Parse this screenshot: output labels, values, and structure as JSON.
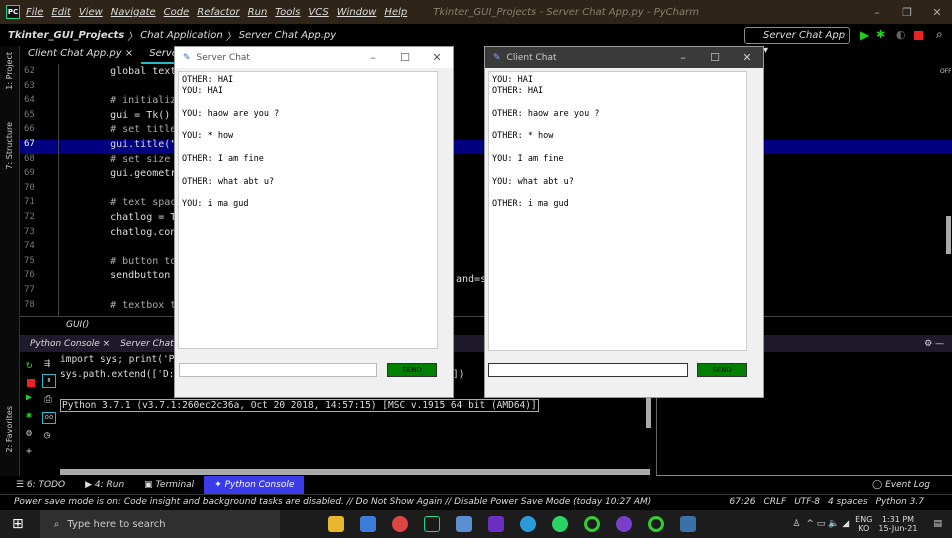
{
  "ide": {
    "menu": [
      "File",
      "Edit",
      "View",
      "Navigate",
      "Code",
      "Refactor",
      "Run",
      "Tools",
      "VCS",
      "Window",
      "Help"
    ],
    "window_title": "Tkinter_GUI_Projects - Server Chat App.py - PyCharm",
    "breadcrumb": [
      "Tkinter_GUI_Projects",
      "Chat Application",
      "Server Chat App.py"
    ],
    "run_config": "Server Chat App",
    "tabs": [
      "Client Chat App.py",
      "Server Chat App.py"
    ],
    "side_tools": [
      "1: Project",
      "7: Structure",
      "2: Favorites"
    ],
    "lines": [
      {
        "n": "62",
        "code": "    global textbox"
      },
      {
        "n": "63",
        "code": ""
      },
      {
        "n": "64",
        "code": "    # initialize tki"
      },
      {
        "n": "65",
        "code": "    gui = Tk()"
      },
      {
        "n": "66",
        "code": "    # set title for"
      },
      {
        "n": "67",
        "code": "    gui.title(\"Serve"
      },
      {
        "n": "68",
        "code": "    # set size for t"
      },
      {
        "n": "69",
        "code": "    gui.geometry(\"40"
      },
      {
        "n": "70",
        "code": ""
      },
      {
        "n": "71",
        "code": "    # text space to"
      },
      {
        "n": "72",
        "code": "    chatlog = Text(g"
      },
      {
        "n": "73",
        "code": "    chatlog.config(s"
      },
      {
        "n": "74",
        "code": ""
      },
      {
        "n": "75",
        "code": "    # button to send"
      },
      {
        "n": "76",
        "code": "    sendbutton = But"
      },
      {
        "n": "77",
        "code": ""
      },
      {
        "n": "78",
        "code": "    # textbox to typ"
      }
    ],
    "code_tail": "and=s",
    "power_off": "OFF",
    "func_crumb": "GUI()",
    "console_tabs": [
      "Python Console",
      "Server Chat"
    ],
    "console_lines": [
      "import sys; print('P",
      "sys.path.extend(['D:"
    ],
    "console_tail": "])",
    "python_banner": "Python 3.7.1 (v3.7.1:260ec2c36a, Oct 20 2018, 14:57:15) [MSC v.1915 64 bit (AMD64)]",
    "bottom_tabs": [
      "6: TODO",
      "4: Run",
      "Terminal",
      "Python Console"
    ],
    "event_log": "Event Log",
    "status_msg": "Power save mode is on: Code insight and background tasks are disabled. // Do Not Show Again // Disable Power Save Mode (today 10:27 AM)",
    "status_right": [
      "67:26",
      "CRLF",
      "UTF-8",
      "4 spaces",
      "Python 3.7"
    ]
  },
  "server": {
    "title": "Server Chat",
    "log": "OTHER: HAI\nYOU: HAI\n\nYOU: haow are you ?\n\nYOU: * how\n\nOTHER: I am fine\n\nOTHER: what abt u?\n\nYOU: i ma gud",
    "entry": "",
    "send": "SEND"
  },
  "client": {
    "title": "Client Chat",
    "log": "YOU: HAI\nOTHER: HAI\n\nOTHER: haow are you ?\n\nOTHER: * how\n\nYOU: I am fine\n\nYOU: what abt u?\n\nOTHER: i ma gud",
    "entry": "",
    "send": "SEND"
  },
  "taskbar": {
    "search_placeholder": "Type here to search",
    "lang": "ENG",
    "lang2": "KO",
    "time": "1:31 PM",
    "date": "15-Jun-21"
  }
}
